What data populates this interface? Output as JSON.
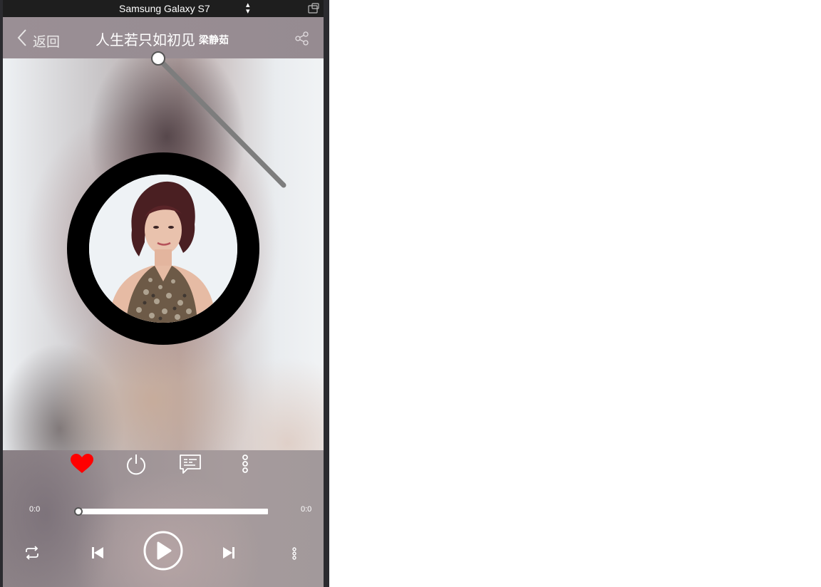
{
  "device": {
    "name": "Samsung Galaxy S7"
  },
  "header": {
    "back_label": "返回",
    "title": "人生若只如初见",
    "artist": "梁静茹"
  },
  "icons": {
    "back": "chevron-left-icon",
    "share": "share-icon",
    "like": "heart-icon",
    "sleep": "power-icon",
    "comment": "comment-icon",
    "more": "more-vertical-icon",
    "repeat": "repeat-icon",
    "prev": "skip-previous-icon",
    "play": "play-icon",
    "next": "skip-next-icon",
    "playlist": "more-vertical-icon"
  },
  "colors": {
    "like": "#ff0000",
    "accent": "#ffffff",
    "disc": "#000000"
  },
  "player": {
    "current_time": "0:0",
    "total_time": "0:0",
    "progress": 0
  }
}
